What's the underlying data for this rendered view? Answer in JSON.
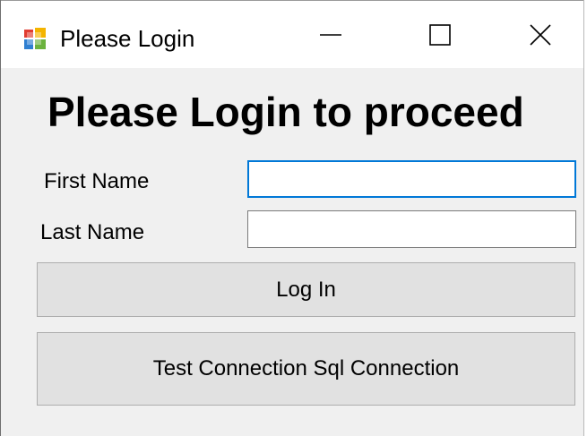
{
  "window": {
    "title": "Please Login",
    "icon": "winforms-app-icon",
    "controls": {
      "minimize_icon": "minimize-icon",
      "maximize_icon": "maximize-icon",
      "close_icon": "close-icon"
    }
  },
  "form": {
    "heading": "Please Login to proceed",
    "first_name": {
      "label": "First Name",
      "value": "",
      "focused": true
    },
    "last_name": {
      "label": "Last Name",
      "value": ""
    },
    "login_button": "Log In",
    "test_button": "Test Connection Sql Connection"
  },
  "colors": {
    "background": "#f0f0f0",
    "titlebar": "#ffffff",
    "focus_border": "#0078d7",
    "button_face": "#e1e1e1",
    "button_border": "#adadad"
  }
}
